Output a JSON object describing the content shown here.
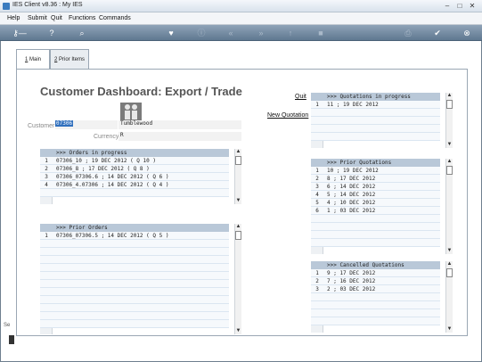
{
  "window": {
    "title": "IES Client v8.36 : My IES"
  },
  "menu": [
    "Help",
    "Submit",
    "Quit",
    "Functions",
    "Commands"
  ],
  "toolbar_icons": [
    "key-icon",
    "help-icon",
    "search-icon",
    "heart-icon",
    "info-icon",
    "rewind-icon",
    "forward-icon",
    "upload-icon",
    "stop-icon",
    "print-icon",
    "check-icon",
    "close-icon"
  ],
  "tabs": [
    {
      "hotkey": "1",
      "label": " Main"
    },
    {
      "hotkey": "2",
      "label": " Prior Items"
    }
  ],
  "page": {
    "heading": "Customer Dashboard: Export / Trade",
    "customer_label": "Customer",
    "customer_code": "07306",
    "customer_name": "Tumblewood",
    "currency_label": "Currency",
    "currency_value": "R",
    "quit_link": "Quit",
    "new_quotation_link": "New Quotation"
  },
  "orders_in_progress": {
    "header": ">>> Orders in progress",
    "rows": [
      {
        "n": "1",
        "text": "07306_10 ; 19 DEC 2012 ( Q 10 )"
      },
      {
        "n": "2",
        "text": "07306_8 ; 17 DEC 2012 ( Q 8 )"
      },
      {
        "n": "3",
        "text": "07306_07306.6 ; 14 DEC 2012 ( Q 6 )"
      },
      {
        "n": "4",
        "text": "07306_4.07306 ; 14 DEC 2012 ( Q 4 )"
      }
    ]
  },
  "prior_orders": {
    "header": ">>> Prior Orders",
    "rows": [
      {
        "n": "1",
        "text": "07306_07306.5 ; 14 DEC 2012 ( Q 5 )"
      }
    ]
  },
  "quotations_in_progress": {
    "header": ">>> Quotations in progress",
    "rows": [
      {
        "n": "1",
        "text": "11 ; 19 DEC 2012"
      }
    ]
  },
  "prior_quotations": {
    "header": ">>> Prior Quotations",
    "rows": [
      {
        "n": "1",
        "text": "10 ; 19 DEC 2012"
      },
      {
        "n": "2",
        "text": "8 ; 17 DEC 2012"
      },
      {
        "n": "3",
        "text": "6 ; 14 DEC 2012"
      },
      {
        "n": "4",
        "text": "5 ; 14 DEC 2012"
      },
      {
        "n": "5",
        "text": "4 ; 10 DEC 2012"
      },
      {
        "n": "6",
        "text": "1 ; 03 DEC 2012"
      }
    ]
  },
  "cancelled_quotations": {
    "header": ">>> Cancelled Quotations",
    "rows": [
      {
        "n": "1",
        "text": "9 ; 17 DEC 2012"
      },
      {
        "n": "2",
        "text": "7 ; 16 DEC 2012"
      },
      {
        "n": "3",
        "text": "2 ; 03 DEC 2012"
      }
    ]
  },
  "side_label": "Se"
}
